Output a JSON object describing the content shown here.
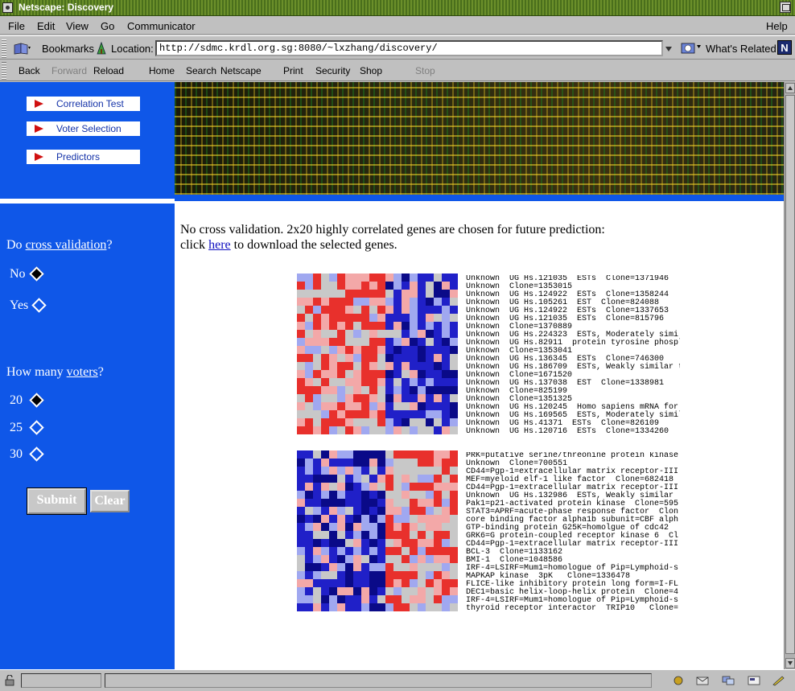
{
  "window": {
    "title": "Netscape: Discovery"
  },
  "menu": {
    "file": "File",
    "edit": "Edit",
    "view": "View",
    "go": "Go",
    "communicator": "Communicator",
    "help": "Help"
  },
  "locationbar": {
    "bookmarks": "Bookmarks",
    "location_label": "Location:",
    "url": "http://sdmc.krdl.org.sg:8080/~lxzhang/discovery/",
    "whats_related": "What's Related"
  },
  "navbar": {
    "back": "Back",
    "forward": "Forward",
    "reload": "Reload",
    "home": "Home",
    "search": "Search",
    "netscape": "Netscape",
    "print": "Print",
    "security": "Security",
    "shop": "Shop",
    "stop": "Stop"
  },
  "sidebar": {
    "links": [
      "Correlation Test",
      "Voter Selection",
      "Predictors"
    ]
  },
  "form": {
    "cv_prefix": "Do ",
    "cv_link": "cross validation",
    "cv_suffix": "?",
    "cv_options": [
      "No",
      "Yes"
    ],
    "cv_selected": "No",
    "voters_prefix": "How many ",
    "voters_link": "voters",
    "voters_suffix": "?",
    "voter_options": [
      "20",
      "25",
      "30"
    ],
    "voters_selected": "20",
    "submit": "Submit",
    "clear": "Clear"
  },
  "main": {
    "line1": "No cross validation. 2x20 highly correlated genes are chosen for future prediction:",
    "line2_prefix": "click ",
    "line2_link": "here",
    "line2_suffix": " to download the selected genes."
  },
  "heatmap_top": {
    "genes": [
      "Unknown  UG Hs.121035  ESTs  Clone=1371946",
      "Unknown  Clone=1353015",
      "Unknown  UG Hs.124922  ESTs  Clone=1358244",
      "Unknown  UG Hs.105261  EST  Clone=824088",
      "Unknown  UG Hs.124922  ESTs  Clone=1337653",
      "Unknown  UG Hs.121035  ESTs  Clone=815796",
      "Unknown  Clone=1370889",
      "Unknown  UG Hs.224323  ESTs, Moderately simi",
      "Unknown  UG Hs.82911  protein tyrosine phospl",
      "Unknown  Clone=1353041",
      "Unknown  UG Hs.136345  ESTs  Clone=746300",
      "Unknown  UG Hs.186709  ESTs, Weakly similar t",
      "Unknown  Clone=1671520",
      "Unknown  UG Hs.137038  EST  Clone=1338981",
      "Unknown  Clone=825199",
      "Unknown  Clone=1351325",
      "Unknown  UG Hs.120245  Homo sapiens mRNA for",
      "Unknown  UG Hs.169565  ESTs, Moderately simil",
      "Unknown  UG Hs.41371  ESTs  Clone=826109",
      "Unknown  UG Hs.120716  ESTs  Clone=1334260"
    ]
  },
  "heatmap_bottom": {
    "genes": [
      "PRK=putative serine/threonine protein kinase",
      "Unknown  Clone=700551",
      "CD44=Pgp-1=extracellular matrix receptor-III:",
      "MEF=myeloid elf-1 like factor  Clone=682418",
      "CD44=Pgp-1=extracellular matrix receptor-III:",
      "Unknown  UG Hs.132986  ESTs, Weakly similar",
      "Pak1=p21-activated protein kinase  Clone=595",
      "STAT3=APRF=acute-phase response factor  Clon",
      "core binding factor alpha1b subunit=CBF alph",
      "GTP-binding protein G25K=homolgue of cdc42",
      "GRK6=G protein-coupled receptor kinase 6  Cl",
      "CD44=Pgp-1=extracellular matrix receptor-III:",
      "BCL-3  Clone=1133162",
      "BMI-1  Clone=1048586",
      "IRF-4=LSIRF=Mum1=homologue of Pip=Lymphoid-s",
      "MAPKAP kinase  3pK   Clone=1336478",
      "FLICE-like inhibitory protein long form=I-FL",
      "DEC1=basic helix-loop-helix protein  Clone=4",
      "IRF-4=LSIRF=Mum1=homologue of Pip=Lymphoid-s",
      "thyroid receptor interactor  TRIP10   Clone="
    ]
  },
  "colors": {
    "sidebar_bg": "#0f57e8",
    "heat_red": "#e8302c",
    "heat_pink": "#f3a8a8",
    "heat_gray": "#c8c8c8",
    "heat_lightblue": "#a0a8f0",
    "heat_blue": "#2020c8",
    "heat_navy": "#0a0a88"
  }
}
